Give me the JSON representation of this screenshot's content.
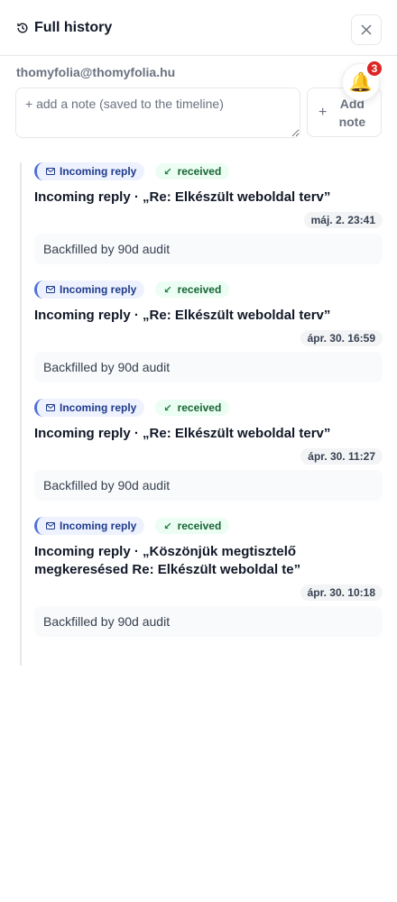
{
  "header": {
    "title": "Full history"
  },
  "contact": {
    "email": "thomyfolia@thomyfolia.hu"
  },
  "note": {
    "placeholder": "+ add a note (saved to the timeline)",
    "add_label": "Add note"
  },
  "notifications": {
    "count": "3"
  },
  "events": [
    {
      "type_label": "Incoming reply",
      "status_label": "received",
      "title": "Incoming reply · „Re: Elkészült weboldal terv”",
      "time": "máj. 2. 23:41",
      "note": "Backfilled by 90d audit"
    },
    {
      "type_label": "Incoming reply",
      "status_label": "received",
      "title": "Incoming reply · „Re: Elkészült weboldal terv”",
      "time": "ápr. 30. 16:59",
      "note": "Backfilled by 90d audit"
    },
    {
      "type_label": "Incoming reply",
      "status_label": "received",
      "title": "Incoming reply · „Re: Elkészült weboldal terv”",
      "time": "ápr. 30. 11:27",
      "note": "Backfilled by 90d audit"
    },
    {
      "type_label": "Incoming reply",
      "status_label": "received",
      "title": "Incoming reply · „Köszönjük megtisztelő megkeresésed Re: Elkészült weboldal te”",
      "time": "ápr. 30. 10:18",
      "note": "Backfilled by 90d audit"
    }
  ],
  "colors": {
    "accent": "#4f6fd6",
    "received": "#166534",
    "badge": "#dc2626"
  }
}
